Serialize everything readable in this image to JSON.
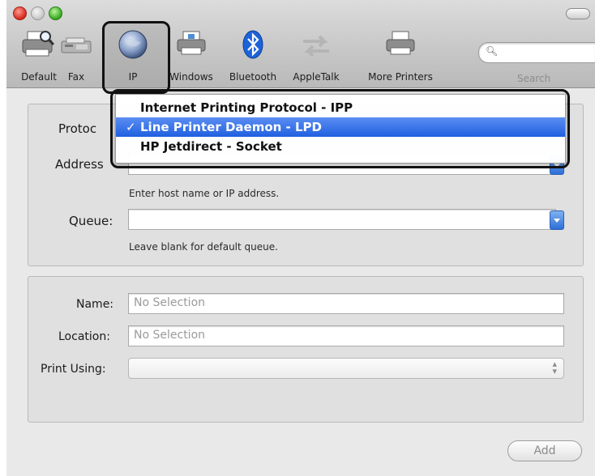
{
  "toolbar": {
    "items": [
      {
        "label": "Default",
        "icon": "printer-search-icon"
      },
      {
        "label": "Fax",
        "icon": "fax-icon"
      },
      {
        "label": "IP",
        "icon": "globe-icon"
      },
      {
        "label": "Windows",
        "icon": "windows-printer-icon"
      },
      {
        "label": "Bluetooth",
        "icon": "bluetooth-icon"
      },
      {
        "label": "AppleTalk",
        "icon": "appletalk-arrows-icon"
      },
      {
        "label": "More Printers",
        "icon": "printer-icon"
      }
    ],
    "selected": "IP",
    "search_label": "Search",
    "search_value": ""
  },
  "protocol": {
    "label": "Protoc",
    "options": [
      {
        "label": "Internet Printing Protocol - IPP",
        "checked": false
      },
      {
        "label": "Line Printer Daemon - LPD",
        "checked": true
      },
      {
        "label": "HP Jetdirect - Socket",
        "checked": false
      }
    ],
    "check_mark": "✓"
  },
  "address": {
    "label": "Address",
    "value": "",
    "hint": "Enter host name or IP address."
  },
  "queue": {
    "label": "Queue:",
    "value": "",
    "hint": "Leave blank for default queue."
  },
  "details": {
    "name_label": "Name:",
    "name_placeholder": "No Selection",
    "location_label": "Location:",
    "location_placeholder": "No Selection",
    "print_using_label": "Print Using:",
    "print_using_value": ""
  },
  "buttons": {
    "add": "Add"
  },
  "colors": {
    "selection_blue": "#2f6ee5",
    "window_bg": "#e9e9e9"
  }
}
